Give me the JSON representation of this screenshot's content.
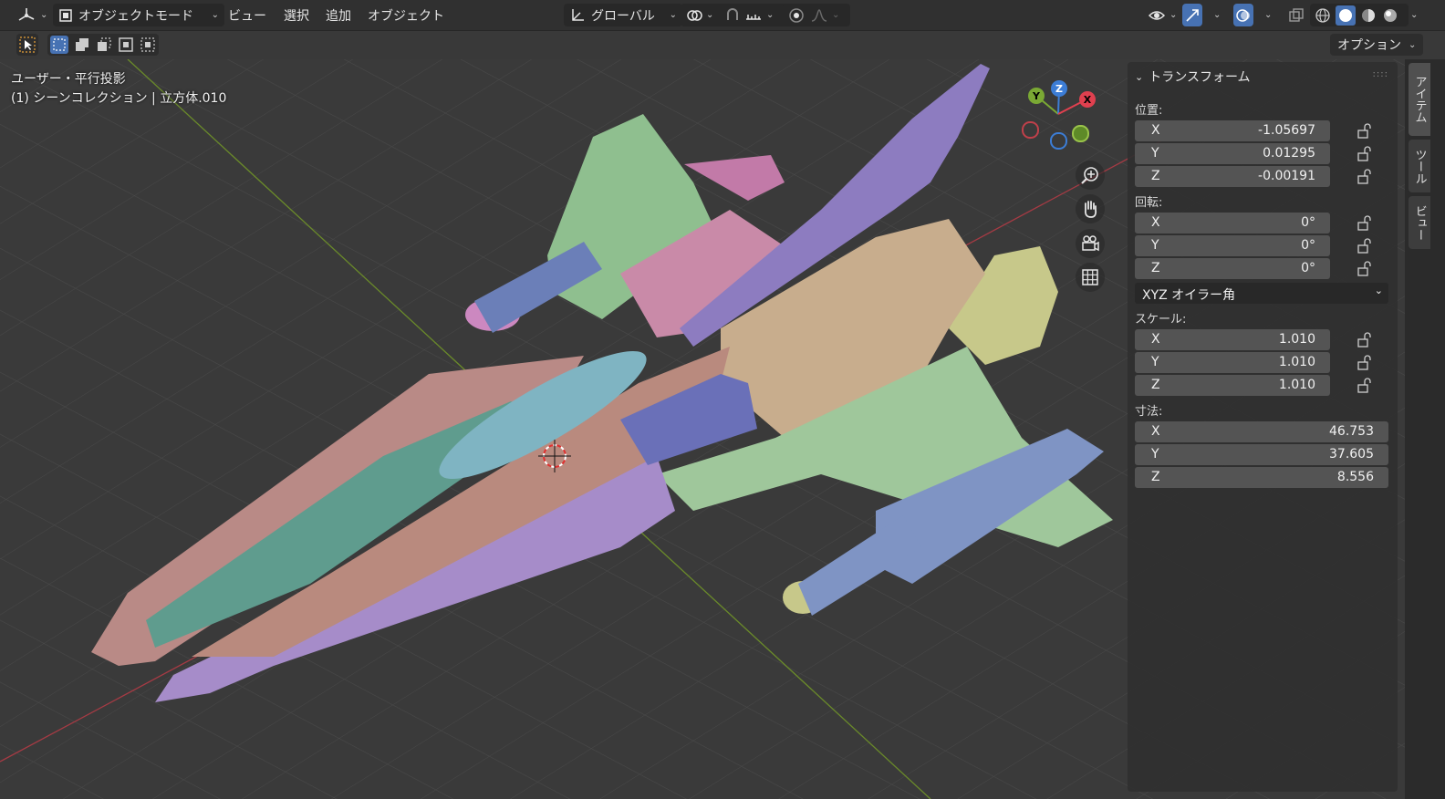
{
  "header": {
    "mode_label": "オブジェクトモード",
    "menus": [
      "ビュー",
      "選択",
      "追加",
      "オブジェクト"
    ],
    "transform_orientation": "グローバル"
  },
  "toolrow": {
    "options_label": "オプション"
  },
  "viewport": {
    "view_name": "ユーザー・平行投影",
    "collection_info": "(1) シーンコレクション | 立方体.010"
  },
  "gizmo": {
    "x": "X",
    "y": "Y",
    "z": "Z"
  },
  "npanel": {
    "section_title": "トランスフォーム",
    "location_label": "位置:",
    "location": [
      {
        "axis": "X",
        "value": "-1.05697"
      },
      {
        "axis": "Y",
        "value": "0.01295"
      },
      {
        "axis": "Z",
        "value": "-0.00191"
      }
    ],
    "rotation_label": "回転:",
    "rotation": [
      {
        "axis": "X",
        "value": "0°"
      },
      {
        "axis": "Y",
        "value": "0°"
      },
      {
        "axis": "Z",
        "value": "0°"
      }
    ],
    "rotation_mode": "XYZ オイラー角",
    "scale_label": "スケール:",
    "scale": [
      {
        "axis": "X",
        "value": "1.010"
      },
      {
        "axis": "Y",
        "value": "1.010"
      },
      {
        "axis": "Z",
        "value": "1.010"
      }
    ],
    "dimensions_label": "寸法:",
    "dimensions": [
      {
        "axis": "X",
        "value": "46.753"
      },
      {
        "axis": "Y",
        "value": "37.605"
      },
      {
        "axis": "Z",
        "value": "8.556"
      }
    ]
  },
  "sidetabs": [
    "アイテム",
    "ツール",
    "ビュー"
  ],
  "colors": {
    "accent": "#4772b3",
    "axis_x": "#e0404f",
    "axis_y": "#7aa834",
    "axis_z": "#3c7dd6"
  }
}
